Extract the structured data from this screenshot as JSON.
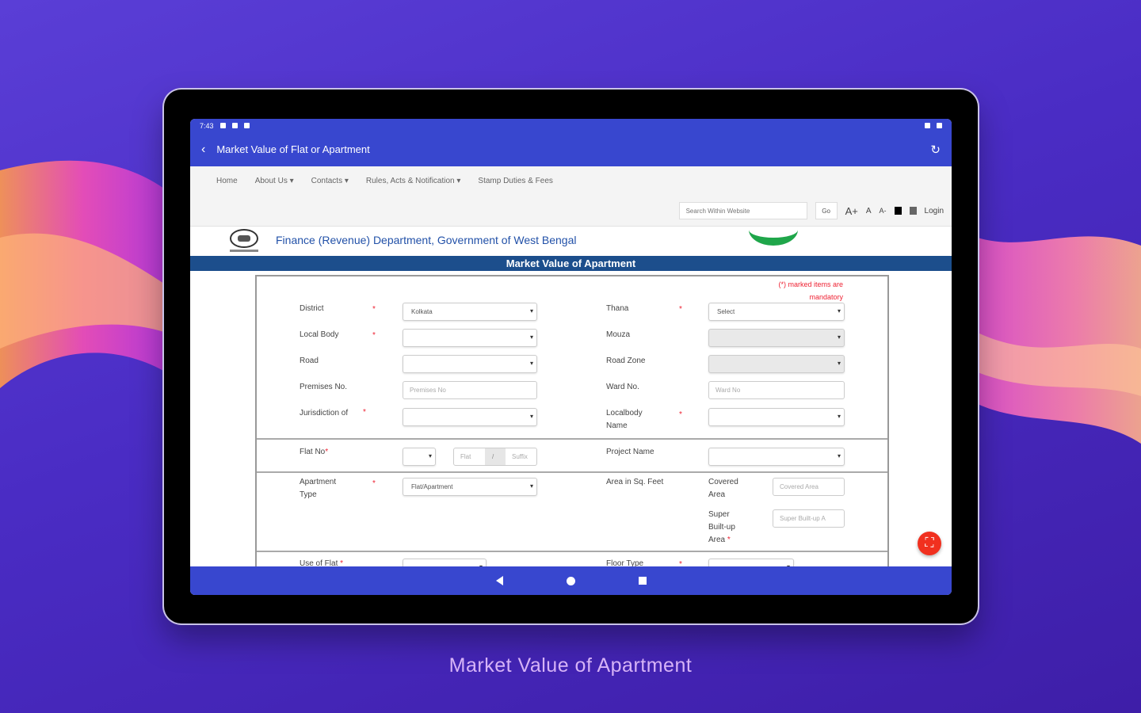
{
  "caption": "Market Value of Apartment",
  "statusbar": {
    "time": "7:43"
  },
  "appbar": {
    "back_icon": "‹",
    "title": "Market Value of Flat or Apartment",
    "refresh_icon": "↻"
  },
  "nav": {
    "links": [
      "Home",
      "About Us ▾",
      "Contacts ▾",
      "Rules, Acts & Notification ▾",
      "Stamp Duties & Fees"
    ],
    "search_placeholder": "Search Within Website",
    "go_label": "Go",
    "font_large": "A+",
    "font_normal": "A",
    "font_small": "A-",
    "login": "Login"
  },
  "header": {
    "department": "Finance (Revenue) Department, Government of West Bengal"
  },
  "banner": "Market Value of Apartment",
  "form": {
    "mandatory_note_1": "(*) marked items are",
    "mandatory_note_2": "mandatory",
    "district_label": "District",
    "district_value": "Kolkata",
    "thana_label": "Thana",
    "thana_value": "Select",
    "local_body_label": "Local Body",
    "mouza_label": "Mouza",
    "road_label": "Road",
    "road_zone_label": "Road Zone",
    "premises_label": "Premises No.",
    "premises_placeholder": "Premises No",
    "ward_label": "Ward No.",
    "ward_placeholder": "Ward No",
    "jurisdiction_label": "Jurisdiction of",
    "localbody_name_label_1": "Localbody",
    "localbody_name_label_2": "Name",
    "flat_label": "Flat No",
    "flat_placeholder": "Flat",
    "flat_sep": "/",
    "flat_suffix": "Suffix",
    "project_label": "Project Name",
    "apt_type_label_1": "Apartment",
    "apt_type_label_2": "Type",
    "apt_type_value": "Flat/Apartment",
    "area_label": "Area in Sq. Feet",
    "covered_label_1": "Covered",
    "covered_label_2": "Area",
    "covered_placeholder": "Covered Area",
    "super_label_1": "Super",
    "super_label_2": "Built-up",
    "super_label_3": "Area",
    "super_placeholder": "Super Built-up A",
    "use_label": "Use of Flat",
    "floor_label": "Floor Type",
    "star": "*"
  }
}
